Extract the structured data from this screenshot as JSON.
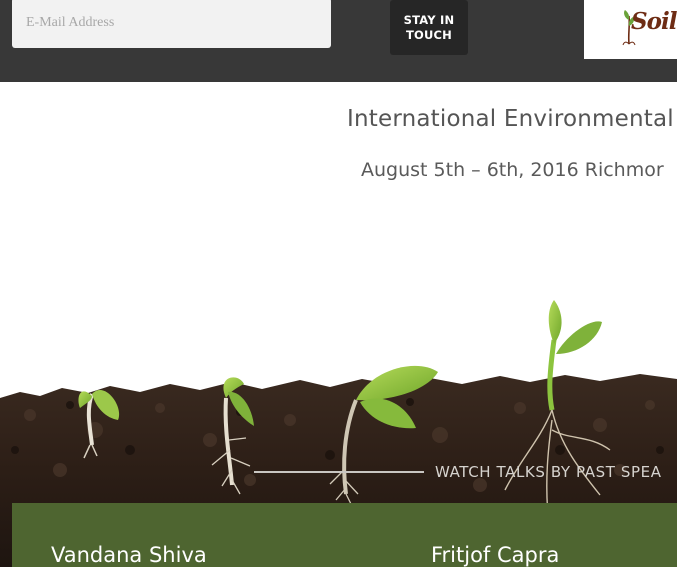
{
  "signup": {
    "email_placeholder": "E-Mail Address",
    "button_line1": "STAY IN",
    "button_line2": "TOUCH"
  },
  "logo": {
    "text": "Soil",
    "icon": "sprout-icon"
  },
  "hero": {
    "title": "International Environmental",
    "date": "August 5th – 6th, 2016 Richmor",
    "image": "seedlings-in-soil"
  },
  "watch": {
    "label": "WATCH TALKS BY PAST SPEA"
  },
  "speakers": {
    "items": [
      {
        "name": "Vandana Shiva"
      },
      {
        "name": "Fritjof Capra"
      }
    ]
  },
  "colors": {
    "topbar": "#383838",
    "button": "#262626",
    "speakers_band": "#4e6530",
    "soil": "#2e1f17",
    "sprout": "#8cc43e"
  }
}
